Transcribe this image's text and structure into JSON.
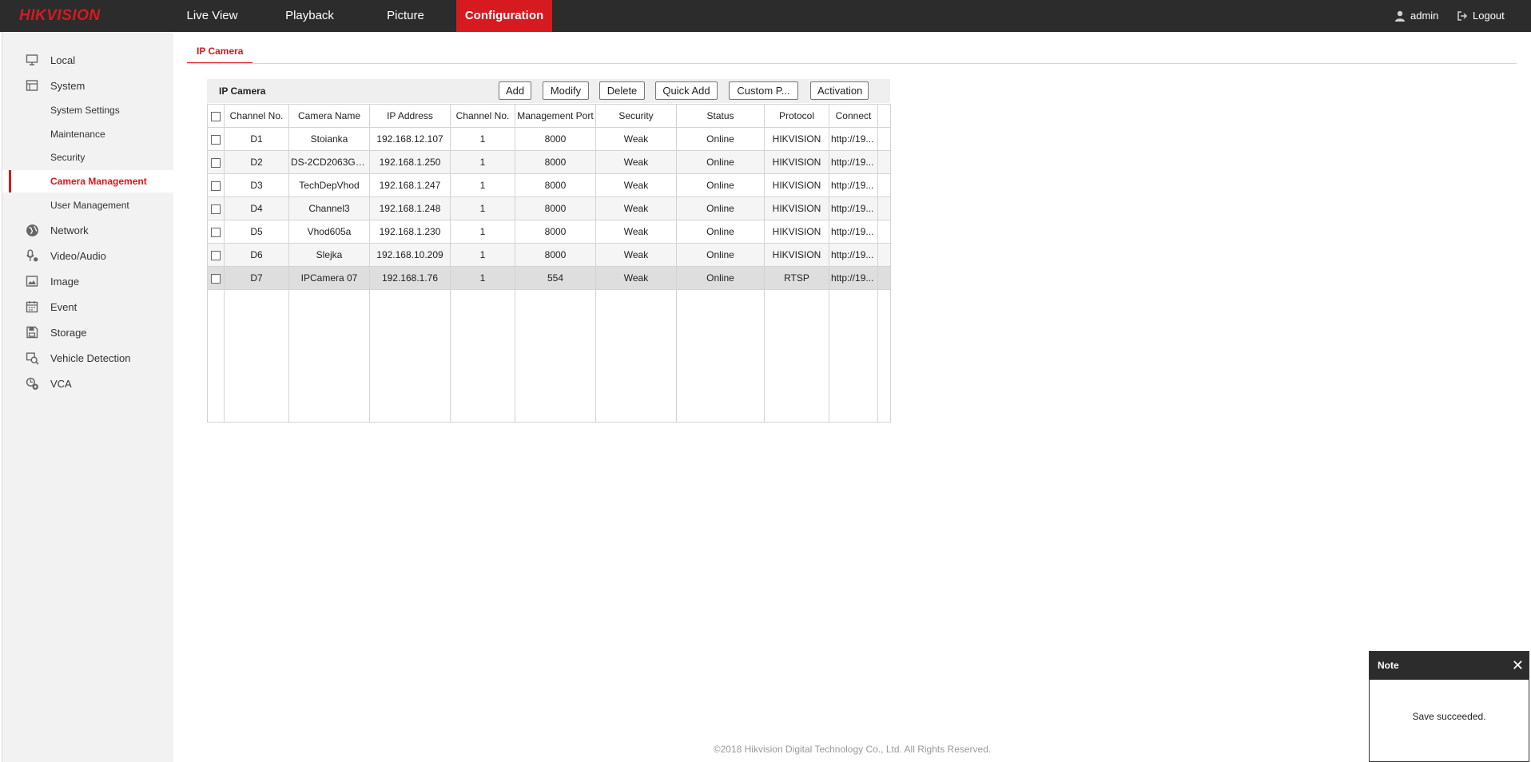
{
  "brand": "HIKVISION",
  "nav": {
    "items": [
      {
        "label": "Live View"
      },
      {
        "label": "Playback"
      },
      {
        "label": "Picture"
      },
      {
        "label": "Configuration"
      }
    ],
    "active": "Configuration",
    "user": "admin",
    "logout": "Logout"
  },
  "sidebar": {
    "items": [
      {
        "label": "Local",
        "icon": "monitor-icon"
      },
      {
        "label": "System",
        "icon": "system-icon"
      },
      {
        "label": "System Settings",
        "sub": true
      },
      {
        "label": "Maintenance",
        "sub": true
      },
      {
        "label": "Security",
        "sub": true
      },
      {
        "label": "Camera Management",
        "sub": true,
        "active": true
      },
      {
        "label": "User Management",
        "sub": true
      },
      {
        "label": "Network",
        "icon": "globe-icon"
      },
      {
        "label": "Video/Audio",
        "icon": "microphone-icon"
      },
      {
        "label": "Image",
        "icon": "image-icon"
      },
      {
        "label": "Event",
        "icon": "calendar-icon"
      },
      {
        "label": "Storage",
        "icon": "storage-icon"
      },
      {
        "label": "Vehicle Detection",
        "icon": "vehicle-search-icon"
      },
      {
        "label": "VCA",
        "icon": "vca-icon"
      }
    ]
  },
  "tab": {
    "label": "IP Camera"
  },
  "grid": {
    "title": "IP Camera",
    "buttons": [
      "Add",
      "Modify",
      "Delete",
      "Quick Add",
      "Custom P...",
      "Activation"
    ],
    "columns": [
      "Channel No.",
      "Camera Name",
      "IP Address",
      "Channel No.",
      "Management Port",
      "Security",
      "Status",
      "Protocol",
      "Connect"
    ],
    "rows": [
      {
        "ch": "D1",
        "name": "Stoianka",
        "ip": "192.168.12.107",
        "chno": "1",
        "port": "8000",
        "security": "Weak",
        "status": "Online",
        "protocol": "HIKVISION",
        "connect": "http://19..."
      },
      {
        "ch": "D2",
        "name": "DS-2CD2063G0...",
        "ip": "192.168.1.250",
        "chno": "1",
        "port": "8000",
        "security": "Weak",
        "status": "Online",
        "protocol": "HIKVISION",
        "connect": "http://19..."
      },
      {
        "ch": "D3",
        "name": "TechDepVhod",
        "ip": "192.168.1.247",
        "chno": "1",
        "port": "8000",
        "security": "Weak",
        "status": "Online",
        "protocol": "HIKVISION",
        "connect": "http://19..."
      },
      {
        "ch": "D4",
        "name": "Channel3",
        "ip": "192.168.1.248",
        "chno": "1",
        "port": "8000",
        "security": "Weak",
        "status": "Online",
        "protocol": "HIKVISION",
        "connect": "http://19..."
      },
      {
        "ch": "D5",
        "name": "Vhod605a",
        "ip": "192.168.1.230",
        "chno": "1",
        "port": "8000",
        "security": "Weak",
        "status": "Online",
        "protocol": "HIKVISION",
        "connect": "http://19..."
      },
      {
        "ch": "D6",
        "name": "Slejka",
        "ip": "192.168.10.209",
        "chno": "1",
        "port": "8000",
        "security": "Weak",
        "status": "Online",
        "protocol": "HIKVISION",
        "connect": "http://19..."
      },
      {
        "ch": "D7",
        "name": "IPCamera 07",
        "ip": "192.168.1.76",
        "chno": "1",
        "port": "554",
        "security": "Weak",
        "status": "Online",
        "protocol": "RTSP",
        "connect": "http://19...",
        "selected": true
      }
    ]
  },
  "footer": "©2018 Hikvision Digital Technology Co., Ltd. All Rights Reserved.",
  "note": {
    "title": "Note",
    "message": "Save succeeded."
  },
  "colors": {
    "brand_red": "#d71920",
    "topbar": "#2c2c2c",
    "sidebar_bg": "#f2f2f2",
    "link": "#0000ee"
  }
}
